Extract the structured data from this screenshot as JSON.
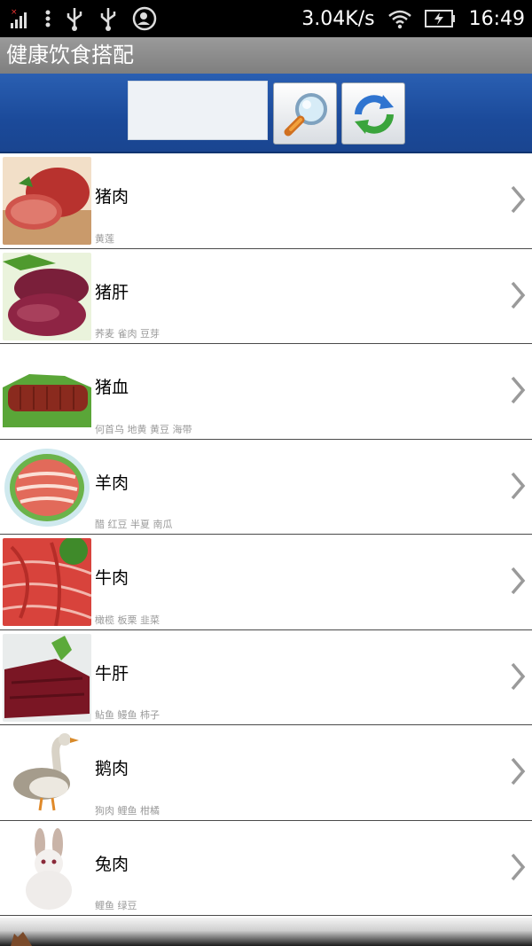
{
  "status_bar": {
    "network_speed": "3.04K/s",
    "time": "16:49",
    "icons": [
      "signal-icon",
      "menu-dots-icon",
      "usb-icon",
      "usb-icon",
      "account-sync-icon",
      "wifi-icon",
      "battery-charging-icon"
    ]
  },
  "app": {
    "title": "健康饮食搭配"
  },
  "search": {
    "placeholder": "",
    "value": ""
  },
  "toolbar": {
    "search_icon": "magnifier-icon",
    "refresh_icon": "refresh-icon"
  },
  "foods": [
    {
      "name": "猪肉",
      "pairs": "黄莲",
      "thumb": "pork-image"
    },
    {
      "name": "猪肝",
      "pairs": "荞麦 雀肉 豆芽",
      "thumb": "pork-liver-image"
    },
    {
      "name": "猪血",
      "pairs": "何首乌 地黄 黄豆 海带",
      "thumb": "pork-blood-image"
    },
    {
      "name": "羊肉",
      "pairs": "醋 红豆 半夏 南瓜",
      "thumb": "mutton-image"
    },
    {
      "name": "牛肉",
      "pairs": "橄榄 板栗 韭菜",
      "thumb": "beef-image"
    },
    {
      "name": "牛肝",
      "pairs": "鲇鱼 鳗鱼 柿子",
      "thumb": "beef-liver-image"
    },
    {
      "name": "鹅肉",
      "pairs": "狗肉 鲤鱼 柑橘",
      "thumb": "goose-image"
    },
    {
      "name": "兔肉",
      "pairs": "鲤鱼 绿豆",
      "thumb": "rabbit-image"
    }
  ],
  "colors": {
    "toolbar_blue": "#1b4a9a",
    "title_bar_gray": "#8a8a8a",
    "sub_text_gray": "#9a9a9a"
  }
}
